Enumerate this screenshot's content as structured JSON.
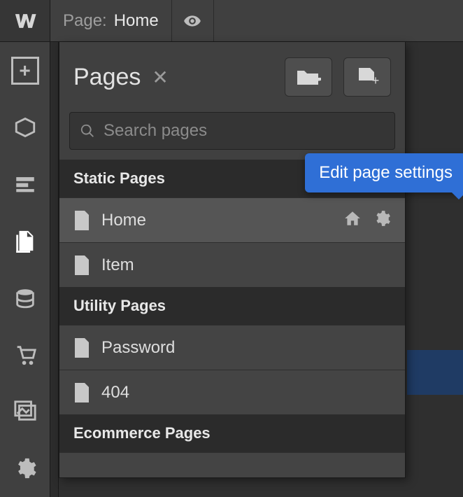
{
  "topbar": {
    "page_label": "Page:",
    "current_page": "Home"
  },
  "panel": {
    "title": "Pages",
    "search_placeholder": "Search pages"
  },
  "sections": [
    {
      "title": "Static Pages",
      "pages": [
        {
          "name": "Home",
          "selected": true
        },
        {
          "name": "Item"
        }
      ]
    },
    {
      "title": "Utility Pages",
      "pages": [
        {
          "name": "Password"
        },
        {
          "name": "404"
        }
      ]
    },
    {
      "title": "Ecommerce Pages",
      "pages": []
    }
  ],
  "tooltip": "Edit page settings"
}
